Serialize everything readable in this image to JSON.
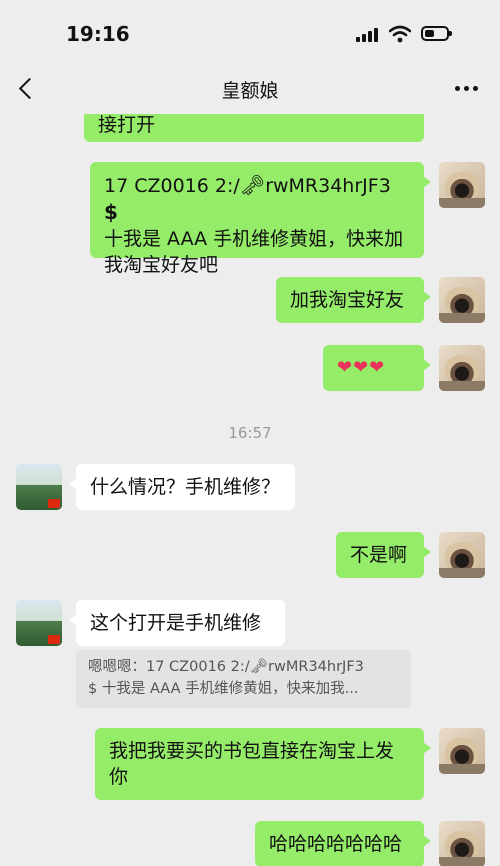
{
  "status": {
    "time": "19:16"
  },
  "nav": {
    "title": "皇额娘"
  },
  "messages": {
    "m0": "接打开",
    "m1_line1": "17 CZ0016  2:/",
    "m1_key": "🗝",
    "m1_line1b": "rwMR34hrJF3",
    "m1_dollar": "$",
    "m1_line2": "十我是 AAA 手机维修黄姐，快来加",
    "m1_line3": "我淘宝好友吧",
    "m2": "加我淘宝好友",
    "m3": "❤❤❤",
    "time1": "16:57",
    "m4": "什么情况？手机维修？",
    "m5": "不是啊",
    "m6": "这个打开是手机维修",
    "quote_line1": "嗯嗯嗯：17 CZ0016  2:/🗝rwMR34hrJF3",
    "quote_line2": "$ 十我是 AAA 手机维修黄姐，快来加我...",
    "m7_line1": "我把我要买的书包直接在淘宝上发",
    "m7_line2": "你",
    "m8": "哈哈哈哈哈哈哈"
  },
  "icons": {
    "back": "back-chevron-icon",
    "more": "more-dots-icon",
    "signal": "cellular-signal-icon",
    "wifi": "wifi-icon",
    "battery": "battery-icon"
  },
  "colors": {
    "background": "#ededed",
    "outgoing_bubble": "#95ec69",
    "incoming_bubble": "#ffffff",
    "timestamp": "#999999"
  }
}
